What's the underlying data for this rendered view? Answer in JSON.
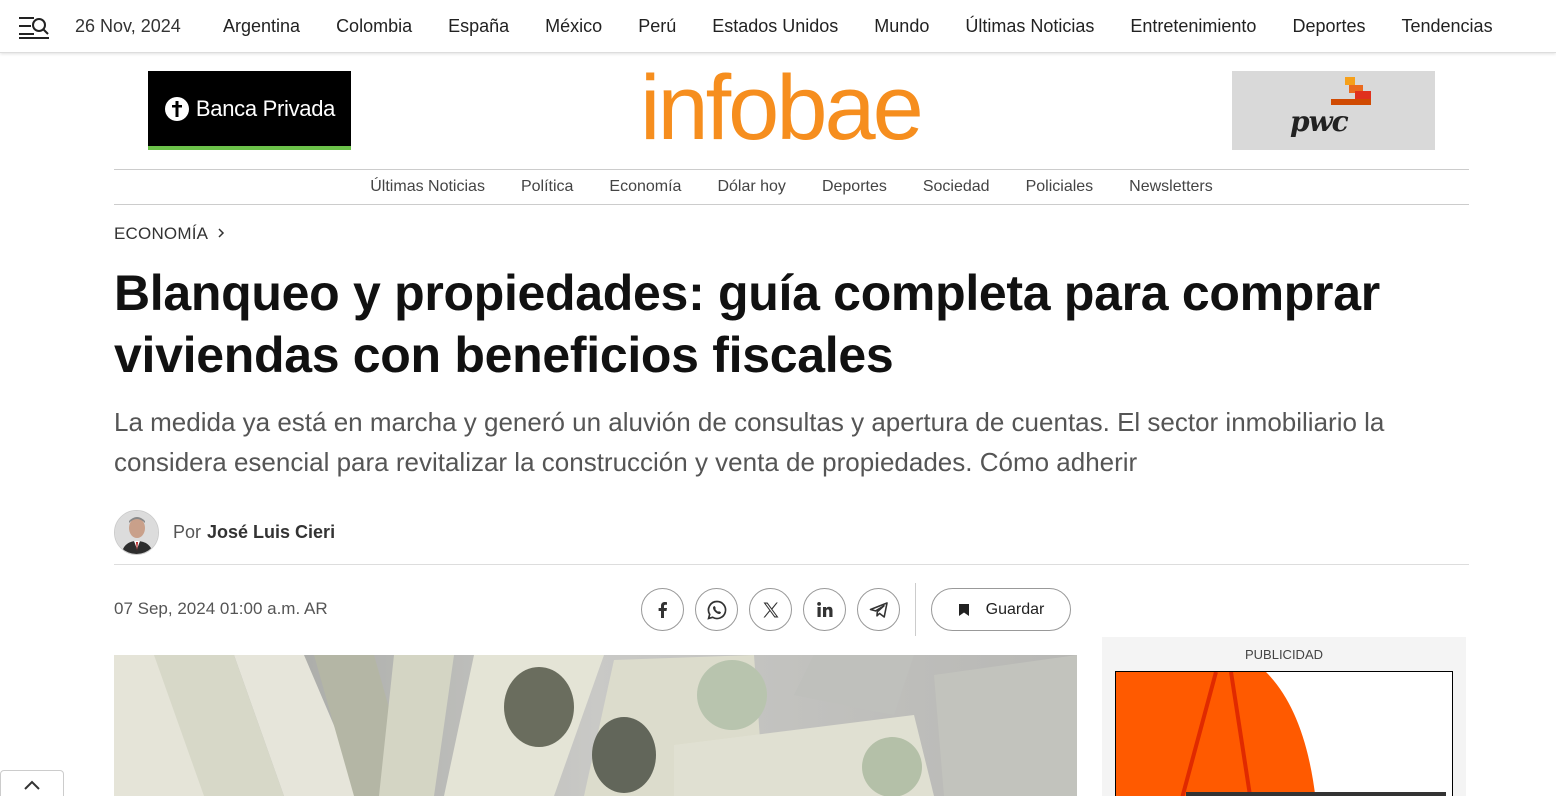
{
  "topbar": {
    "date": "26 Nov, 2024",
    "nav": [
      "Argentina",
      "Colombia",
      "España",
      "México",
      "Perú",
      "Estados Unidos",
      "Mundo",
      "Últimas Noticias",
      "Entretenimiento",
      "Deportes",
      "Tendencias"
    ]
  },
  "header": {
    "logo": "infobae",
    "ad_left_text": "Banca Privada",
    "ad_right_text": "pwc"
  },
  "subnav": [
    "Últimas Noticias",
    "Política",
    "Economía",
    "Dólar hoy",
    "Deportes",
    "Sociedad",
    "Policiales",
    "Newsletters"
  ],
  "article": {
    "section": "ECONOMÍA",
    "title": "Blanqueo y propiedades: guía completa para comprar viviendas con beneficios fiscales",
    "subtitle": "La medida ya está en marcha y generó un aluvión de consultas y apertura de cuentas. El sector inmobiliario la considera esencial para revitalizar la construcción y venta de propiedades. Cómo adherir",
    "author_prefix": "Por",
    "author": "José Luis Cieri",
    "date": "07 Sep, 2024 01:00 a.m. AR",
    "save_label": "Guardar"
  },
  "share_icons": [
    "facebook-icon",
    "whatsapp-icon",
    "x-icon",
    "linkedin-icon",
    "telegram-icon"
  ],
  "sidebar": {
    "ad_label": "PUBLICIDAD"
  },
  "colors": {
    "brand": "#f68e1e",
    "banca_accent": "#6cc24a",
    "ad_orange": "#ff5a00"
  }
}
